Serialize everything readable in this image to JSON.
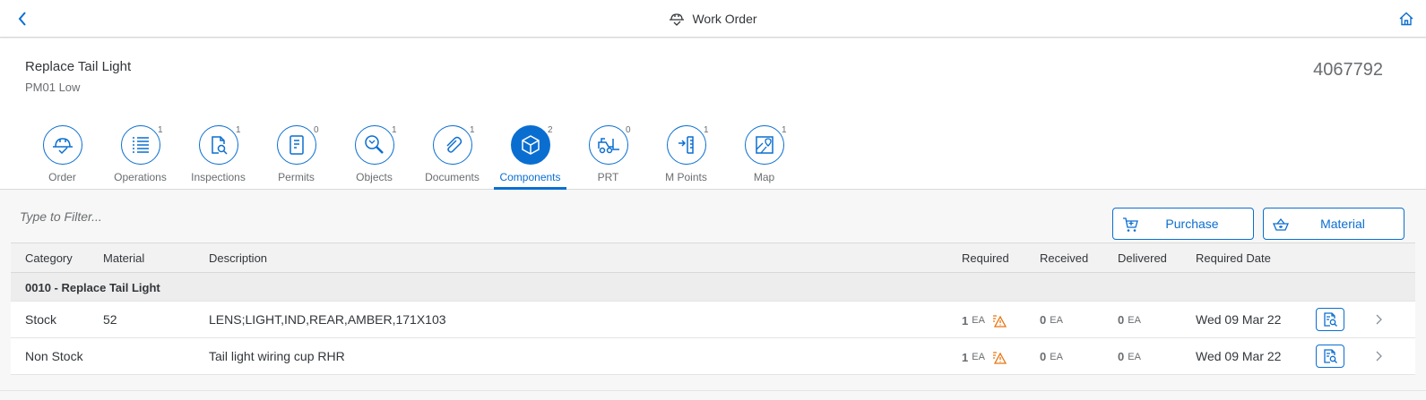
{
  "shell": {
    "title": "Work Order",
    "back_icon": "chevron-left-icon",
    "title_icon": "hardhat-icon",
    "home_icon": "home-icon",
    "accent_color": "#0a6ed1"
  },
  "header": {
    "title": "Replace Tail Light",
    "subtitle": "PM01 Low",
    "order_number": "4067792"
  },
  "tabs": [
    {
      "label": "Order",
      "count": "",
      "icon": "order-hardhat-icon",
      "selected": false
    },
    {
      "label": "Operations",
      "count": "1",
      "icon": "operations-list-icon",
      "selected": false
    },
    {
      "label": "Inspections",
      "count": "1",
      "icon": "inspections-doc-search-icon",
      "selected": false
    },
    {
      "label": "Permits",
      "count": "0",
      "icon": "permits-doc-icon",
      "selected": false
    },
    {
      "label": "Objects",
      "count": "1",
      "icon": "objects-search-icon",
      "selected": false
    },
    {
      "label": "Documents",
      "count": "1",
      "icon": "paperclip-icon",
      "selected": false
    },
    {
      "label": "Components",
      "count": "2",
      "icon": "cube-icon",
      "selected": true
    },
    {
      "label": "PRT",
      "count": "0",
      "icon": "forklift-icon",
      "selected": false
    },
    {
      "label": "M Points",
      "count": "1",
      "icon": "measuring-point-icon",
      "selected": false
    },
    {
      "label": "Map",
      "count": "1",
      "icon": "map-icon",
      "selected": false
    }
  ],
  "filter": {
    "placeholder": "Type to Filter..."
  },
  "actions": {
    "purchase_label": "Purchase",
    "material_label": "Material"
  },
  "table": {
    "columns": [
      "Category",
      "Material",
      "Description",
      "Required",
      "Received",
      "Delivered",
      "Required Date"
    ],
    "group_label": "0010 - Replace Tail Light",
    "rows": [
      {
        "category": "Stock",
        "material": "52",
        "description": "LENS;LIGHT,IND,REAR,AMBER,171X103",
        "required": "1",
        "required_unit": "EA",
        "received": "0",
        "received_unit": "EA",
        "delivered": "0",
        "delivered_unit": "EA",
        "required_date": "Wed 09 Mar 22"
      },
      {
        "category": "Non Stock",
        "material": "",
        "description": "Tail light wiring cup RHR",
        "required": "1",
        "required_unit": "EA",
        "received": "0",
        "received_unit": "EA",
        "delivered": "0",
        "delivered_unit": "EA",
        "required_date": "Wed 09 Mar 22"
      }
    ]
  }
}
